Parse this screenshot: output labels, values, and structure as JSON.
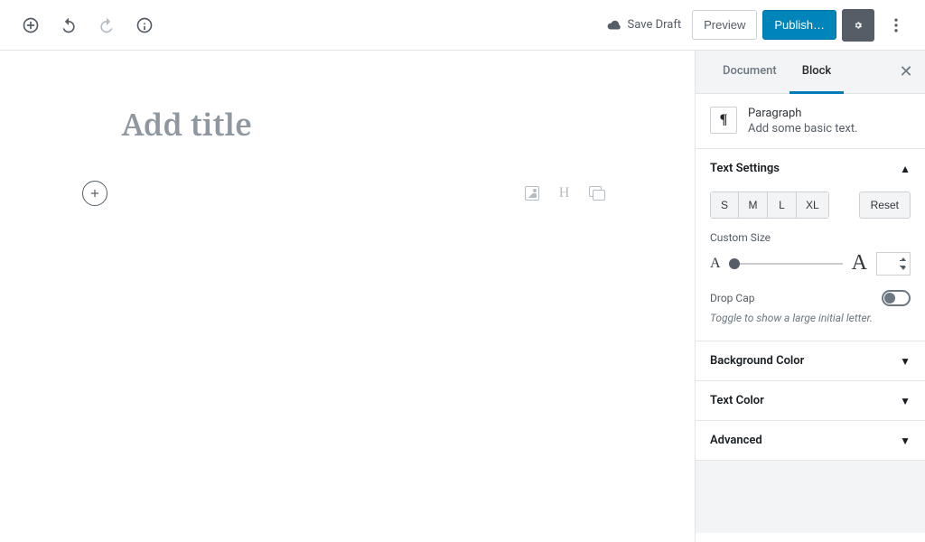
{
  "toolbar": {
    "save_draft": "Save Draft",
    "preview": "Preview",
    "publish": "Publish…"
  },
  "editor": {
    "title_placeholder": "Add title"
  },
  "sidebar": {
    "tabs": {
      "document": "Document",
      "block": "Block"
    },
    "block_header": {
      "name": "Paragraph",
      "desc": "Add some basic text."
    },
    "text_settings": {
      "title": "Text Settings",
      "sizes": [
        "S",
        "M",
        "L",
        "XL"
      ],
      "reset": "Reset",
      "custom_label": "Custom Size",
      "drop_cap_label": "Drop Cap",
      "drop_cap_desc": "Toggle to show a large initial letter."
    },
    "bg_color": "Background Color",
    "text_color": "Text Color",
    "advanced": "Advanced"
  }
}
